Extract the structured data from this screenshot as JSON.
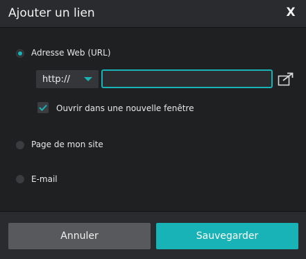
{
  "dialog": {
    "title": "Ajouter un lien",
    "close_label": "X"
  },
  "options": {
    "web_url": {
      "label": "Adresse Web (URL)",
      "selected": true
    },
    "page": {
      "label": "Page de mon site",
      "selected": false
    },
    "email": {
      "label": "E-mail",
      "selected": false
    }
  },
  "url": {
    "protocol": "http://",
    "value": "",
    "new_window_label": "Ouvrir dans une nouvelle fenêtre",
    "new_window_checked": true
  },
  "footer": {
    "cancel_label": "Annuler",
    "save_label": "Sauvegarder"
  },
  "colors": {
    "accent": "#17b3b7",
    "background": "#1f2022",
    "header": "#2a2b2e",
    "cancel_button": "#58595c"
  },
  "icons": {
    "close": "close-icon",
    "dropdown": "chevron-down-icon",
    "external_link": "external-link-icon",
    "check": "check-icon"
  }
}
